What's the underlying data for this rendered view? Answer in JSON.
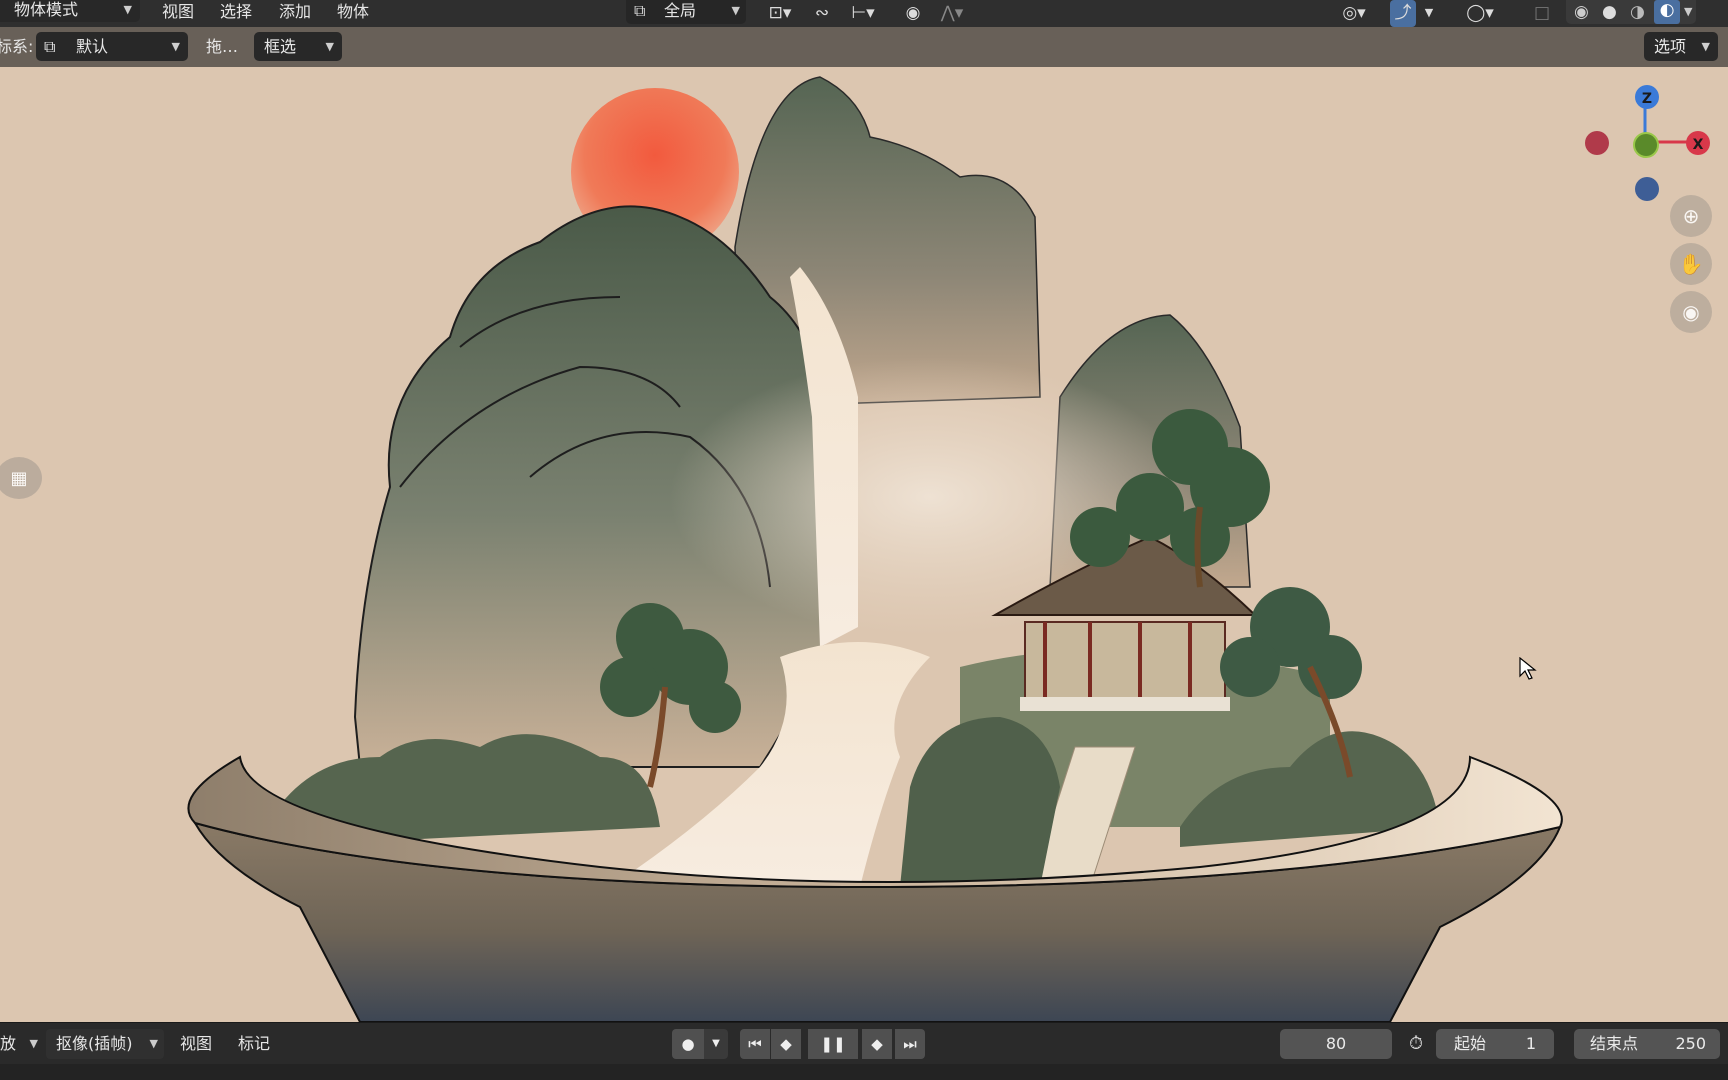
{
  "topbar": {
    "mode_dropdown": "物体模式",
    "menus": [
      "视图",
      "选择",
      "添加",
      "物体"
    ],
    "transform_orientation": "全局"
  },
  "header": {
    "coord_label": "标系:",
    "orientation_value": "默认",
    "drag_label": "拖…",
    "select_mode": "框选",
    "options": "选项"
  },
  "gizmo": {
    "z": "Z",
    "x": "X"
  },
  "timeline": {
    "playback": "放",
    "keying": "抠像(插帧)",
    "view": "视图",
    "marker": "标记",
    "current_frame": "80",
    "start_label": "起始",
    "start_value": "1",
    "end_label": "结束点",
    "end_value": "250"
  },
  "colors": {
    "viewport_bg": "#dcc6b0",
    "sun": "#f06a4e",
    "mountain": "#4e5e48",
    "axis_x": "#d8384a",
    "axis_y": "#6a9a30",
    "axis_z": "#3a7ad8"
  }
}
